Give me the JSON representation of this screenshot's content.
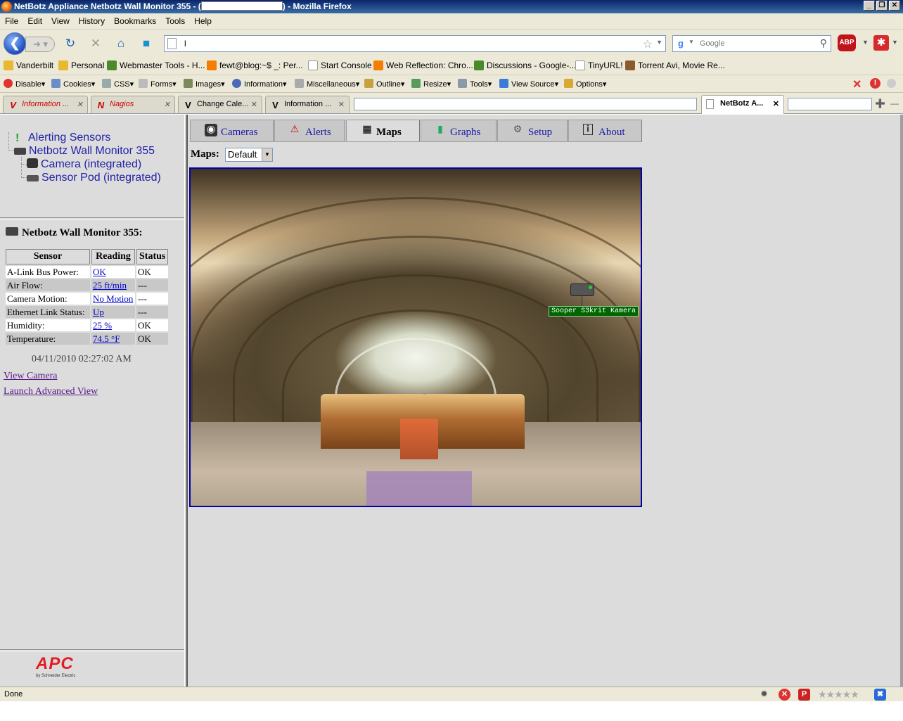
{
  "window": {
    "title_prefix": "NetBotz Appliance Netbotz Wall Monitor 355 - (",
    "title_suffix": ") - Mozilla Firefox",
    "controls": [
      "_",
      "❐",
      "✕"
    ]
  },
  "menu": [
    "File",
    "Edit",
    "View",
    "History",
    "Bookmarks",
    "Tools",
    "Help"
  ],
  "navbar": {
    "url": "l",
    "search_placeholder": "Google",
    "abp_label": "ABP"
  },
  "bookmarks": [
    {
      "label": "Vanderbilt",
      "color": "#e8b830"
    },
    {
      "label": "Personal",
      "color": "#e8b830"
    },
    {
      "label": "Webmaster Tools - H...",
      "color": "#4a8a2a"
    },
    {
      "label": "fewt@blog:~$ _: Per...",
      "color": "#f57d00"
    },
    {
      "label": "Start Console",
      "color": "#ffffff"
    },
    {
      "label": "Web Reflection: Chro...",
      "color": "#f57d00"
    },
    {
      "label": "Discussions - Google-...",
      "color": "#4a8a2a"
    },
    {
      "label": "TinyURL!",
      "color": "#ffffff"
    },
    {
      "label": "Torrent Avi, Movie Re...",
      "color": "#8b5a2b"
    }
  ],
  "devtoolbar": [
    "Disable",
    "Cookies",
    "CSS",
    "Forms",
    "Images",
    "Information",
    "Miscellaneous",
    "Outline",
    "Resize",
    "Tools",
    "View Source",
    "Options"
  ],
  "tabs": [
    {
      "label": "Information ...",
      "icon": "V"
    },
    {
      "label": "Nagios",
      "icon": "N"
    },
    {
      "label": "Change Cale...",
      "icon": "V"
    },
    {
      "label": "Information ...",
      "icon": "V"
    },
    {
      "label": "NetBotz A...",
      "icon": ""
    }
  ],
  "tree": {
    "alerting": "Alerting Sensors",
    "device": "Netbotz Wall Monitor 355",
    "camera": "Camera (integrated)",
    "pod": "Sensor Pod (integrated)"
  },
  "device_panel": {
    "title": "Netbotz Wall Monitor 355:",
    "headers": [
      "Sensor",
      "Reading",
      "Status"
    ],
    "rows": [
      {
        "sensor": "A-Link Bus Power:",
        "reading": "OK",
        "status": "OK"
      },
      {
        "sensor": "Air Flow:",
        "reading": "25 ft/min",
        "status": "---"
      },
      {
        "sensor": "Camera Motion:",
        "reading": "No Motion",
        "status": "---"
      },
      {
        "sensor": "Ethernet Link Status:",
        "reading": "Up",
        "status": "---"
      },
      {
        "sensor": "Humidity:",
        "reading": "25 %",
        "status": "OK"
      },
      {
        "sensor": "Temperature:",
        "reading": "74.5 °F",
        "status": "OK"
      }
    ],
    "timestamp": "04/11/2010 02:27:02 AM",
    "view_camera": "View Camera",
    "launch_advanced": "Launch Advanced View"
  },
  "logo": {
    "text": "APC",
    "sub": "by Schneider Electric"
  },
  "app_tabs": [
    {
      "label": "Cameras",
      "icon": "camera-icon",
      "active": false
    },
    {
      "label": "Alerts",
      "icon": "alert-icon",
      "active": false
    },
    {
      "label": "Maps",
      "icon": "map-icon",
      "active": true
    },
    {
      "label": "Graphs",
      "icon": "graph-icon",
      "active": false
    },
    {
      "label": "Setup",
      "icon": "gear-icon",
      "active": false
    },
    {
      "label": "About",
      "icon": "info-icon",
      "active": false
    }
  ],
  "maps": {
    "label": "Maps:",
    "selected": "Default",
    "sensor_label": "Sooper S3krit Kamera"
  },
  "status": {
    "text": "Done"
  }
}
